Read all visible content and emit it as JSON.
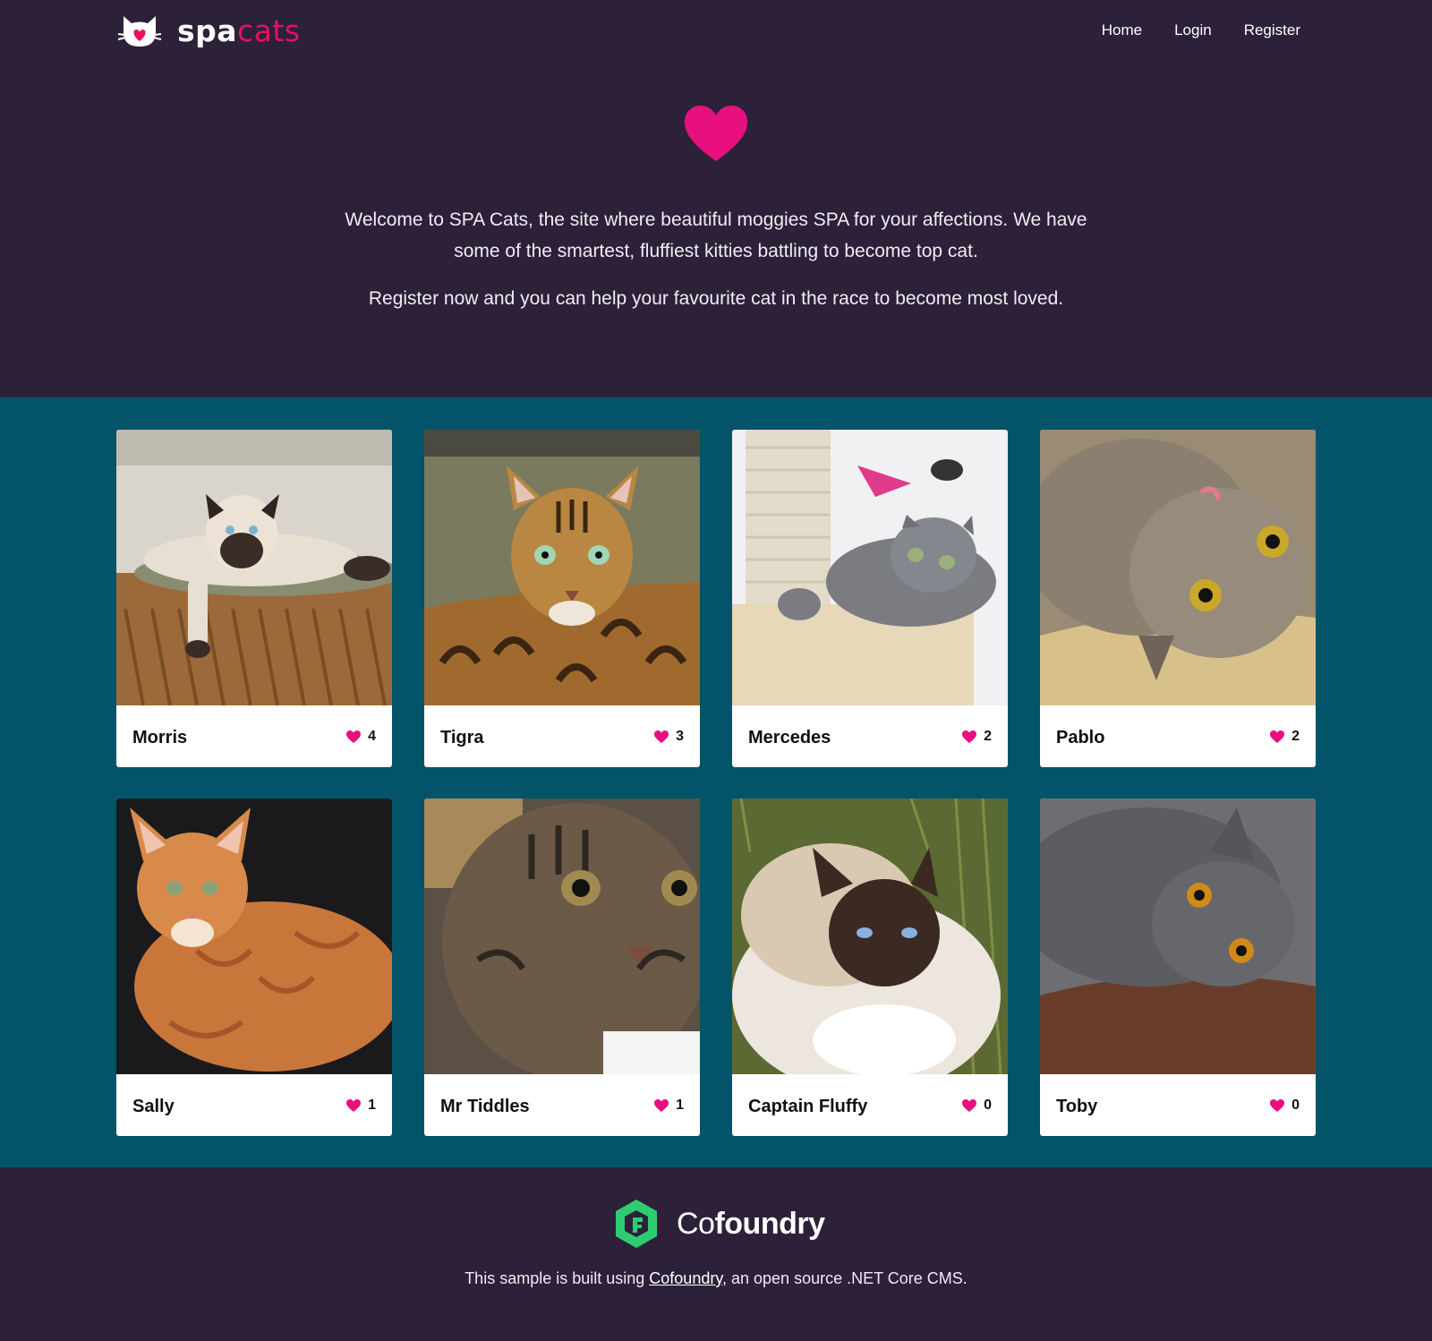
{
  "brand": {
    "part1": "spa",
    "part2": "cats"
  },
  "nav": {
    "items": [
      {
        "label": "Home"
      },
      {
        "label": "Login"
      },
      {
        "label": "Register"
      }
    ]
  },
  "hero": {
    "intro": "Welcome to SPA Cats, the site where beautiful moggies SPA for your affections. We have some of the smartest, fluffiest kitties battling to become top cat.",
    "cta": "Register now and you can help your favourite cat in the race to become most loved."
  },
  "cats": [
    {
      "name": "Morris",
      "likes": "4"
    },
    {
      "name": "Tigra",
      "likes": "3"
    },
    {
      "name": "Mercedes",
      "likes": "2"
    },
    {
      "name": "Pablo",
      "likes": "2"
    },
    {
      "name": "Sally",
      "likes": "1"
    },
    {
      "name": "Mr Tiddles",
      "likes": "1"
    },
    {
      "name": "Captain Fluffy",
      "likes": "0"
    },
    {
      "name": "Toby",
      "likes": "0"
    }
  ],
  "footer": {
    "logo_part1": "Co",
    "logo_part2": "foundry",
    "note_before": "This sample is built using ",
    "note_link": "Cofoundry",
    "note_after": ", an open source .NET Core CMS."
  },
  "colors": {
    "header_bg": "#2c2138",
    "gallery_bg": "#035468",
    "accent_pink": "#e8107e",
    "brand_pink": "#e8105f",
    "cofoundry_green": "#2ecc71"
  }
}
